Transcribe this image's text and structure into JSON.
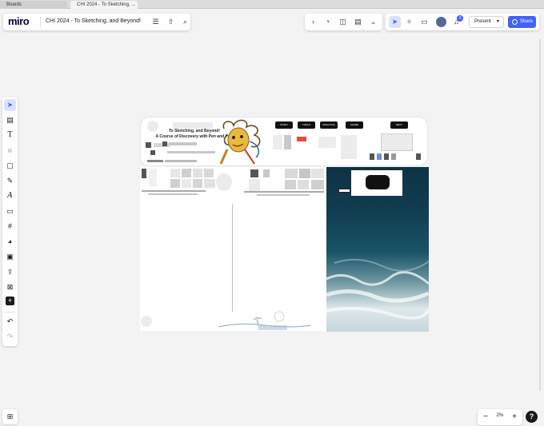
{
  "browser": {
    "tabs": [
      {
        "label": "Boards",
        "active": false
      },
      {
        "label": "CHI 2024 - To Sketching, ...",
        "active": true
      }
    ]
  },
  "header": {
    "logo": "miro",
    "board_title": "CHI 2024 - To Sketching, and Beyond!",
    "icons": [
      "menu-icon",
      "upload-icon",
      "search-icon"
    ]
  },
  "toolbar_right": {
    "icons": [
      "chevron-right-icon",
      "timer-icon",
      "frame-icon",
      "notes-icon",
      "more-icon"
    ]
  },
  "collaboration": {
    "icons": [
      "cursor-select-icon",
      "celebrate-icon",
      "comment-icon",
      "avatar",
      "bell-icon"
    ],
    "notification_count": "3",
    "present_label": "Present",
    "share_label": "Share",
    "accent_color": "#4262ff"
  },
  "left_toolbar": {
    "tools": [
      {
        "name": "select",
        "icon": "cursor-icon",
        "glyph": "➤",
        "selected": true
      },
      {
        "name": "templates",
        "icon": "template-icon",
        "glyph": "▤"
      },
      {
        "name": "text",
        "icon": "text-icon",
        "glyph": "T"
      },
      {
        "name": "shapes",
        "icon": "circle-icon",
        "glyph": "○"
      },
      {
        "name": "sticky-note",
        "icon": "sticky-note-icon",
        "glyph": "▢"
      },
      {
        "name": "pen",
        "icon": "pen-icon",
        "glyph": "✎"
      },
      {
        "name": "text-style",
        "icon": "letter-a-icon",
        "glyph": "A"
      },
      {
        "name": "comment",
        "icon": "comment-icon",
        "glyph": "▭"
      },
      {
        "name": "frame",
        "icon": "frame-tool-icon",
        "glyph": "#"
      },
      {
        "name": "reactions",
        "icon": "palette-icon",
        "glyph": "◕"
      },
      {
        "name": "image",
        "icon": "image-icon",
        "glyph": "▣"
      },
      {
        "name": "upload",
        "icon": "upload-icon",
        "glyph": "⇪"
      },
      {
        "name": "apps",
        "icon": "apps-icon",
        "glyph": "⊠"
      },
      {
        "name": "add-more",
        "icon": "plus-square-icon",
        "glyph": "+"
      }
    ],
    "undo_icon": "undo-icon",
    "redo_icon": "redo-icon"
  },
  "bottom": {
    "frames_icon": "frames-grid-icon",
    "zoom_out": "−",
    "zoom_level": "2%",
    "zoom_in": "+",
    "help": "?"
  },
  "board": {
    "banner_title": "To Sketching, and Beyond!",
    "banner_subtitle": "A Course of Discovery with Pen and Paper"
  }
}
